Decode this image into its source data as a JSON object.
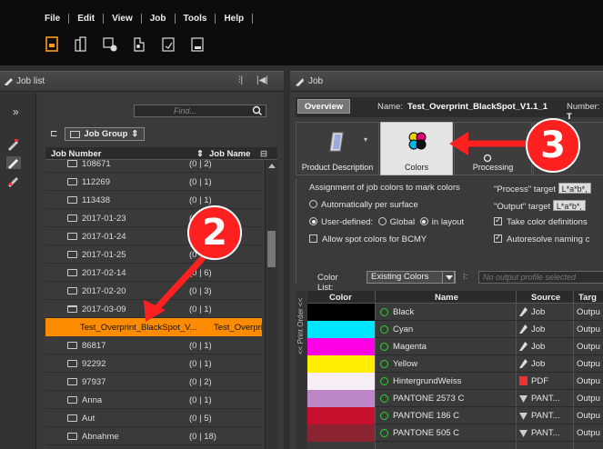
{
  "menu": [
    "File",
    "Edit",
    "View",
    "Job",
    "Tools",
    "Help"
  ],
  "toolbar_icons": [
    "new-job-icon",
    "job-structure-icon",
    "job-settings-icon",
    "job-processing-icon",
    "job-report-icon",
    "job-log-icon"
  ],
  "left_panel": {
    "title": "Job list",
    "find_placeholder": "Find...",
    "group_label": "Job Group",
    "columns": {
      "job_number": "Job Number",
      "job_name": "Job Name"
    },
    "rows": [
      {
        "name": "108671",
        "count": "(0 | 2)"
      },
      {
        "name": "112269",
        "count": "(0 | 1)"
      },
      {
        "name": "113438",
        "count": "(0 | 1)"
      },
      {
        "name": "2017-01-23",
        "count": "(0"
      },
      {
        "name": "2017-01-24",
        "count": "(0"
      },
      {
        "name": "2017-01-25",
        "count": "(0"
      },
      {
        "name": "2017-02-14",
        "count": "(0 | 6)"
      },
      {
        "name": "2017-02-20",
        "count": "(0 | 3)"
      },
      {
        "name": "2017-03-09",
        "count": "(0 | 1)",
        "open": true
      },
      {
        "name": "Test_Overprint_BlackSpot_V...",
        "job_name": "Test_Overpri",
        "selected": true
      },
      {
        "name": "86817",
        "count": "(0 | 1)"
      },
      {
        "name": "92292",
        "count": "(0 | 1)"
      },
      {
        "name": "97937",
        "count": "(0 | 2)"
      },
      {
        "name": "Anna",
        "count": "(0 | 1)"
      },
      {
        "name": "Aut",
        "count": "(0 | 5)"
      },
      {
        "name": "Abnahme",
        "count": "(0 | 18)"
      }
    ]
  },
  "right_panel": {
    "title": "Job",
    "overview_tab": "Overview",
    "name_label": "Name:",
    "name_value": "Test_Overprint_BlackSpot_V1.1_1",
    "number_label": "Number:",
    "number_value": "T",
    "category_tabs": [
      {
        "label": "Product Description",
        "icon": "product-description-icon"
      },
      {
        "label": "Colors",
        "icon": "colors-icon",
        "active": true
      },
      {
        "label": "Processing",
        "icon": "processing-icon"
      }
    ],
    "colors_settings": {
      "assignment_label": "Assignment of job colors to mark colors",
      "auto_label": "Automatically per surface",
      "user_defined_label": "User-defined:",
      "global_label": "Global",
      "in_layout_label": "in layout",
      "allow_spot_label": "Allow spot colors for BCMY",
      "process_target_label": "\"Process\" target",
      "process_target_value": "L*a*b*,",
      "output_target_label": "\"Output\" target",
      "output_target_value": "L*a*b*,",
      "take_color_label": "Take color definitions",
      "autoresolve_label": "Autoresolve naming c",
      "mode": "user-defined",
      "user_defined_scope": "in layout",
      "allow_spot_checked": false,
      "take_color_checked": true,
      "autoresolve_checked": true
    },
    "color_list": {
      "label": "Color List:",
      "selected": "Existing Colors",
      "profile_placeholder": "No output profile selected",
      "print_order_label": "<< Print Order <<"
    },
    "color_table": {
      "columns": {
        "color": "Color",
        "name": "Name",
        "source": "Source",
        "target": "Targ"
      },
      "rows": [
        {
          "swatch": "#000000",
          "name": "Black",
          "source": "Job",
          "source_icon": "job-icon",
          "target": "Outpu"
        },
        {
          "swatch": "#00e5ff",
          "name": "Cyan",
          "source": "Job",
          "source_icon": "job-icon",
          "target": "Outpu"
        },
        {
          "swatch": "#ff00e6",
          "name": "Magenta",
          "source": "Job",
          "source_icon": "job-icon",
          "target": "Outpu"
        },
        {
          "swatch": "#ffee00",
          "name": "Yellow",
          "source": "Job",
          "source_icon": "job-icon",
          "target": "Outpu"
        },
        {
          "swatch": "#f6eef4",
          "name": "HintergrundWeiss",
          "source": "PDF",
          "source_icon": "pdf-icon",
          "target": "Outpu"
        },
        {
          "swatch": "#bd86c8",
          "name": "PANTONE 2573 C",
          "source": "PANT...",
          "source_icon": "pantone-icon",
          "target": "Outpu"
        },
        {
          "swatch": "#c8102e",
          "name": "PANTONE 186 C",
          "source": "PANT...",
          "source_icon": "pantone-icon",
          "target": "Outpu"
        },
        {
          "swatch": "#8a2432",
          "name": "PANTONE 505 C",
          "source": "PANT...",
          "source_icon": "pantone-icon",
          "target": "Outpu"
        }
      ]
    }
  },
  "callouts": [
    {
      "number": "2",
      "color": "#ff2020"
    },
    {
      "number": "3",
      "color": "#ff2020"
    }
  ],
  "colors": {
    "selection": "#ff8c00",
    "callout": "#ff2020",
    "status_dot": "#2fd12f"
  }
}
